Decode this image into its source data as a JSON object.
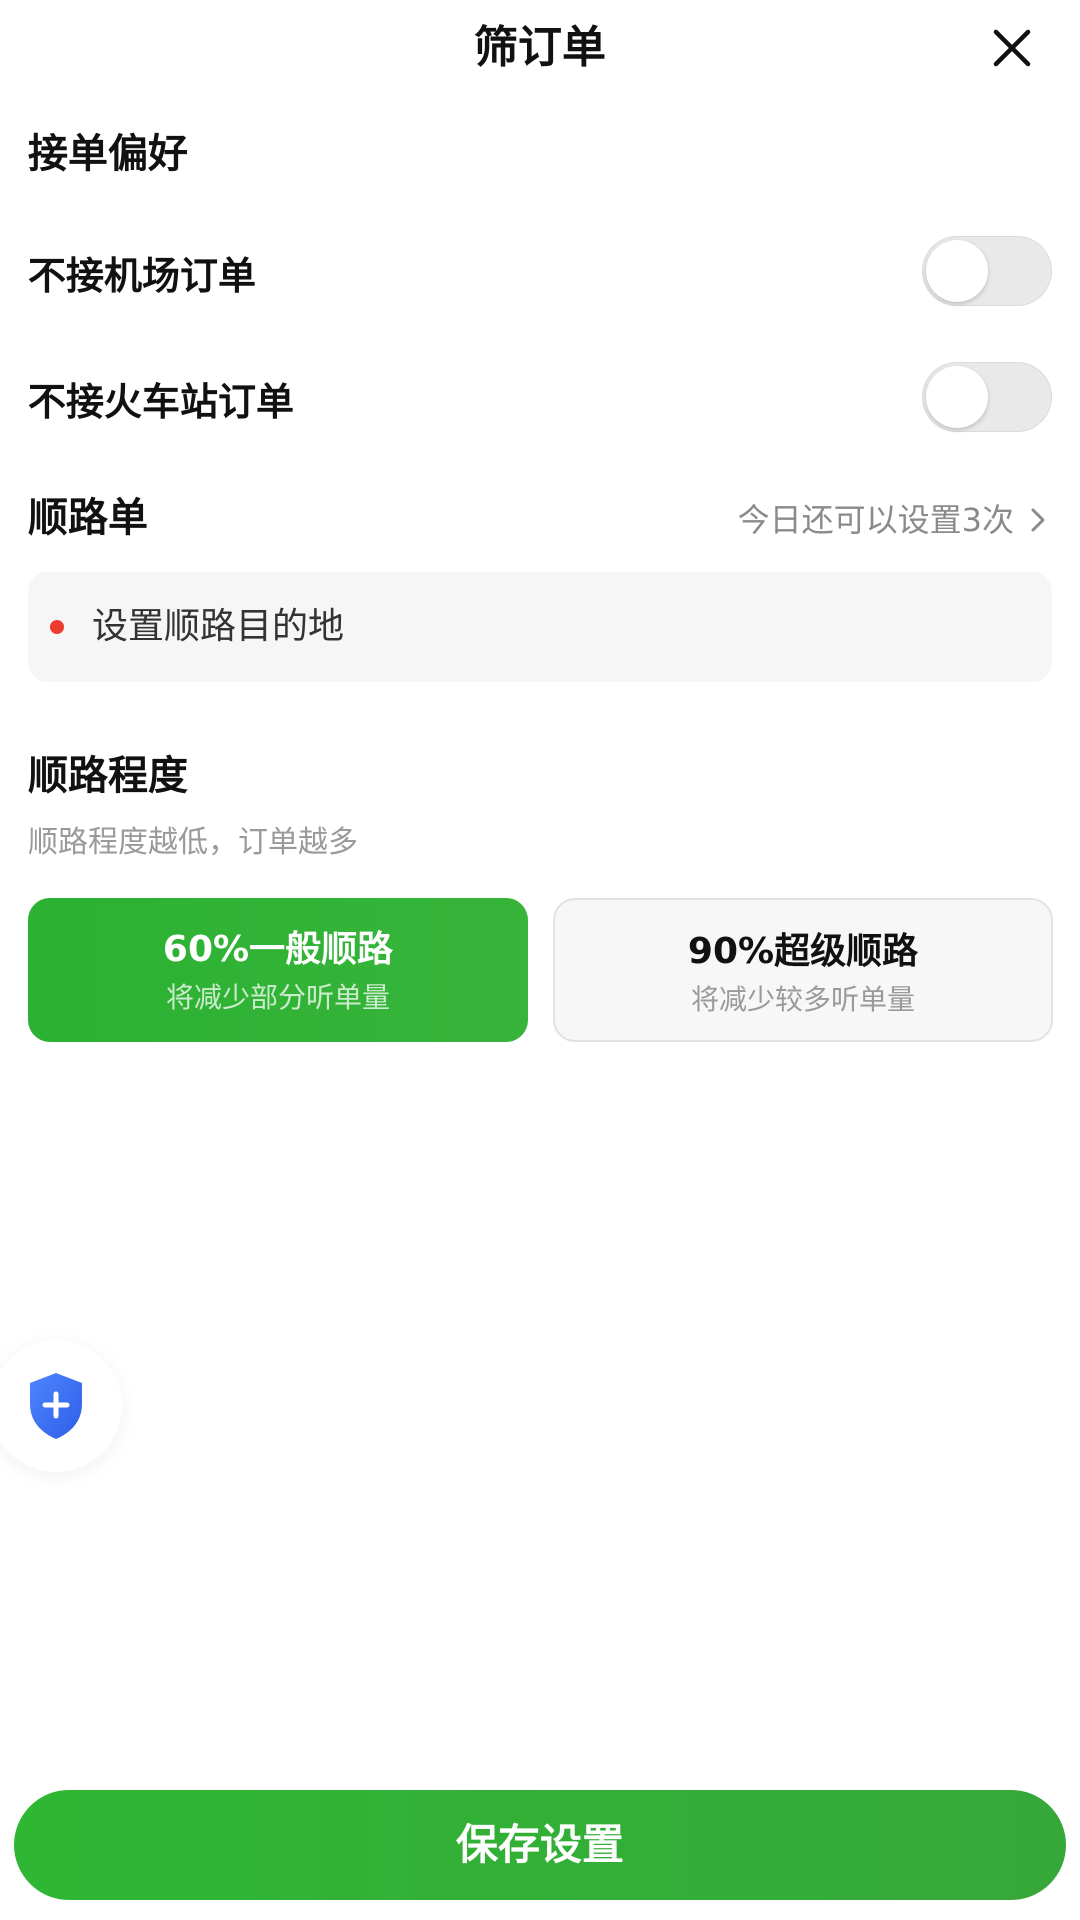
{
  "header": {
    "title": "筛订单"
  },
  "preferences": {
    "title": "接单偏好",
    "items": [
      {
        "label": "不接机场订单",
        "enabled": false
      },
      {
        "label": "不接火车站订单",
        "enabled": false
      }
    ]
  },
  "route": {
    "title": "顺路单",
    "remaining_text": "今日还可以设置3次",
    "destination_placeholder": "设置顺路目的地"
  },
  "route_level": {
    "title": "顺路程度",
    "description": "顺路程度越低，订单越多",
    "options": [
      {
        "name": "60%一般顺路",
        "subtitle": "将减少部分听单量",
        "selected": true
      },
      {
        "name": "90%超级顺路",
        "subtitle": "将减少较多听单量",
        "selected": false
      }
    ]
  },
  "save_button": {
    "label": "保存设置"
  },
  "colors": {
    "accent_green": "#2bb232",
    "dot_red": "#ee3b2f",
    "shield_blue": "#3a6cf5"
  }
}
